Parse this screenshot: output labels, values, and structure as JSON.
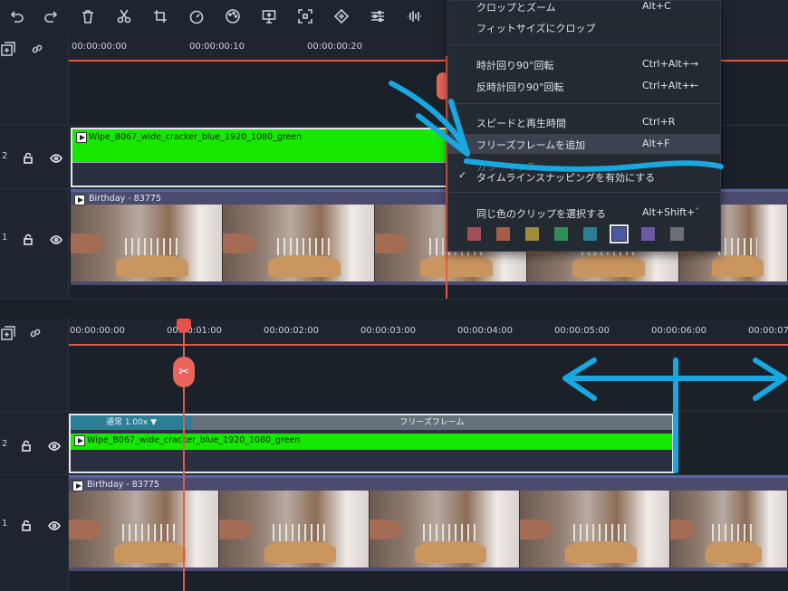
{
  "toolbar": {
    "icons": [
      "undo-icon",
      "redo-icon",
      "trash-icon",
      "scissors-icon",
      "crop-icon",
      "speed-icon",
      "palette-icon",
      "export-frame-icon",
      "fit-icon",
      "keyframe-icon",
      "adjust-icon",
      "audio-wave-icon"
    ]
  },
  "top": {
    "ruler": [
      "00:00:00:00",
      "00:00:00:10",
      "00:00:00:20"
    ],
    "track2": {
      "num": "2",
      "clip": "Wipe_B067_wide_cracker_blue_1920_1080_green"
    },
    "track1": {
      "num": "1",
      "clip": "Birthday - 83775"
    }
  },
  "menu": {
    "items": [
      {
        "label": "クロップとズーム",
        "shortcut": "Alt+C"
      },
      {
        "label": "フィットサイズにクロップ",
        "shortcut": ""
      },
      {
        "label": "時計回り90°回転",
        "shortcut": "Ctrl+Alt+→"
      },
      {
        "label": "反時計回り90°回転",
        "shortcut": "Ctrl+Alt+←"
      },
      {
        "label": "スピードと再生時間",
        "shortcut": "Ctrl+R"
      },
      {
        "label": "フリーズフレームを追加",
        "shortcut": "Alt+F"
      },
      {
        "label": "カラーマッチ",
        "shortcut": ""
      },
      {
        "label": "タイムラインスナッピングを有効にする",
        "shortcut": ""
      },
      {
        "label": "同じ色のクリップを選択する",
        "shortcut": "Alt+Shift+`"
      }
    ],
    "checkmark": "✓",
    "swatches": [
      "#a24f57",
      "#a65e47",
      "#a08a3b",
      "#2f8d5a",
      "#2a7f95",
      "#4a5aa0",
      "#6d5aa4",
      "#6a7276"
    ]
  },
  "bottom": {
    "ruler": [
      "00:00:00:00",
      "00:00:01:00",
      "00:00:02:00",
      "00:00:03:00",
      "00:00:04:00",
      "00:00:05:00",
      "00:00:06:00",
      "00:00:07:"
    ],
    "speed_label": "通常 1.00x ▼",
    "freeze_label": "フリーズフレーム",
    "track2": {
      "num": "2",
      "clip": "Wipe_B067_wide_cracker_blue_1920_1080_green"
    },
    "track1": {
      "num": "1",
      "clip": "Birthday - 83775"
    }
  },
  "colors": {
    "accent": "#e35a4b",
    "annotation": "#19a7e0",
    "green_clip": "#17e800"
  }
}
